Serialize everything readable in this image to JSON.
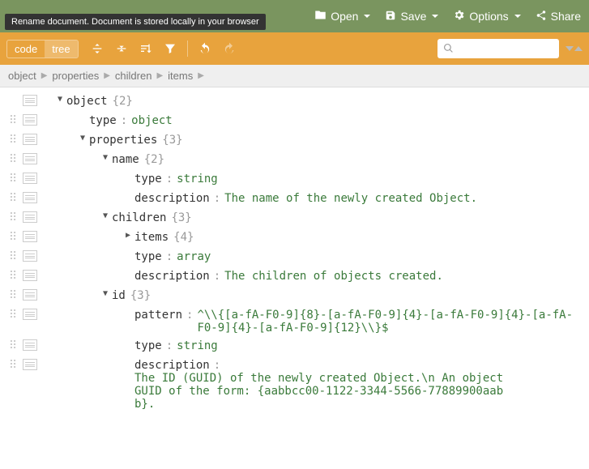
{
  "tooltip": "Rename document. Document is stored locally in your browser",
  "menu": {
    "open": "Open",
    "save": "Save",
    "options": "Options",
    "share": "Share"
  },
  "modes": {
    "code": "code",
    "tree": "tree"
  },
  "search": {
    "placeholder": ""
  },
  "breadcrumb": [
    "object",
    "properties",
    "children",
    "items"
  ],
  "tree": {
    "root_label": "object",
    "root_count": "{2}",
    "rows": [
      {
        "key": "type",
        "val": "object",
        "kind": "kw"
      },
      {
        "key": "properties",
        "count": "{3}",
        "expand": "open"
      },
      {
        "key": "name",
        "count": "{2}",
        "expand": "open"
      },
      {
        "key": "type",
        "val": "string",
        "kind": "kw"
      },
      {
        "key": "description",
        "val": "The name of the newly created Object.",
        "kind": "str"
      },
      {
        "key": "children",
        "count": "{3}",
        "expand": "open"
      },
      {
        "key": "items",
        "count": "{4}",
        "expand": "closed"
      },
      {
        "key": "type",
        "val": "array",
        "kind": "kw"
      },
      {
        "key": "description",
        "val": "The children of objects created.",
        "kind": "str"
      },
      {
        "key": "id",
        "count": "{3}",
        "expand": "open"
      },
      {
        "key": "pattern",
        "val": "^\\\\{[a-fA-F0-9]{8}-[a-fA-F0-9]{4}-[a-fA-F0-9]{4}-[a-fA-F0-9]{4}-[a-fA-F0-9]{12}\\\\}$",
        "kind": "str"
      },
      {
        "key": "type",
        "val": "string",
        "kind": "kw"
      },
      {
        "key": "description",
        "val": "The ID (GUID) of the newly created Object.\\n An object GUID of the form: {aabbcc00-1122-3344-5566-77889900aabb}.",
        "kind": "str"
      }
    ]
  }
}
